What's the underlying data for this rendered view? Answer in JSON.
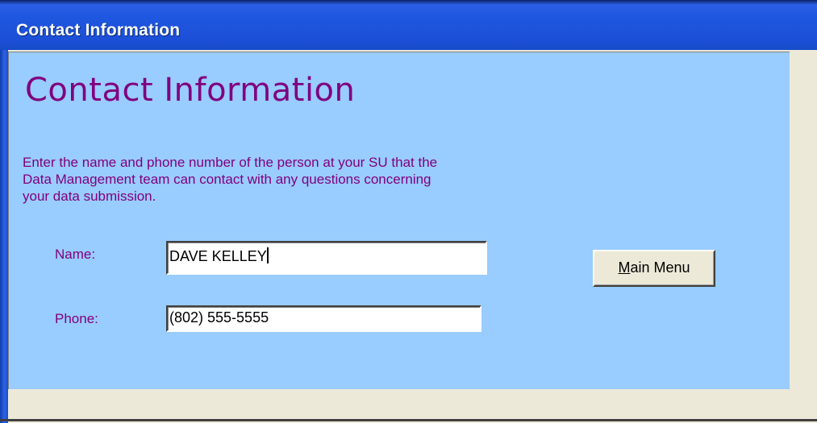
{
  "window": {
    "title": "Contact Information"
  },
  "form": {
    "header": "Contact Information",
    "instructions_lines": [
      "Enter the name and phone number of the person at your SU that the",
      "Data Management team can contact with any questions concerning",
      "your data submission."
    ],
    "name_label": "Name:",
    "name_value": "DAVE KELLEY",
    "phone_label": "Phone:",
    "phone_value": "(802) 555-5555",
    "main_menu_accel": "M",
    "main_menu_rest": "ain Menu"
  },
  "colors": {
    "form_background": "#99ccff",
    "label_text": "#800080",
    "titlebar": "#1f57e0",
    "window_background": "#ece9d8"
  }
}
